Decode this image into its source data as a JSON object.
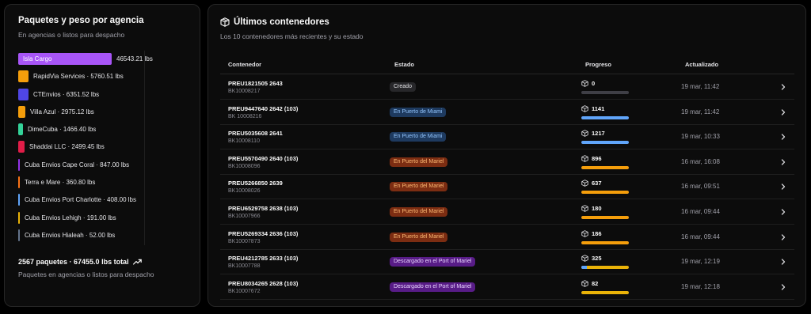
{
  "left_panel": {
    "title": "Paquetes y peso por agencia",
    "subtitle": "En agencias o listos para despacho",
    "totals": "2567 paquetes · 67455.0 lbs total",
    "totals_sub": "Paquetes en agencias o listos para despacho",
    "trend_icon": "trending-up-icon"
  },
  "chart_data": {
    "type": "bar",
    "orientation": "horizontal",
    "categories": [
      "Isla Cargo",
      "RapidVia Services",
      "CTEnvios",
      "Villa Azul",
      "DimeCuba",
      "Shaddai LLC",
      "Cuba Envios Cape Coral",
      "Terra e Mare",
      "Cuba Envios Port Charlotte",
      "Cuba Envios Lehigh",
      "Cuba Envios Hialeah"
    ],
    "values": [
      46543.21,
      5760.51,
      6351.52,
      2975.12,
      1466.4,
      2499.45,
      847.0,
      360.8,
      408.0,
      191.0,
      52.0
    ],
    "labels": [
      "46543.21 lbs",
      "RapidVia Services · 5760.51 lbs",
      "CTEnvios · 6351.52 lbs",
      "Villa Azul · 2975.12 lbs",
      "DimeCuba · 1466.40 lbs",
      "Shaddai LLC · 2499.45 lbs",
      "Cuba Envios Cape Coral · 847.00 lbs",
      "Terra e Mare · 360.80 lbs",
      "Cuba Envios Port Charlotte · 408.00 lbs",
      "Cuba Envios Lehigh · 191.00 lbs",
      "Cuba Envios Hialeah · 52.00 lbs"
    ],
    "colors": [
      "#a855f7",
      "#f59e0b",
      "#4f46e5",
      "#f59e0b",
      "#34d399",
      "#e11d48",
      "#9333ea",
      "#f97316",
      "#60a5fa",
      "#eab308",
      "#64748b"
    ],
    "inline_label_first": "Isla Cargo"
  },
  "right_panel": {
    "title": "Últimos contenedores",
    "subtitle": "Los 10 contenedores más recientes y su estado",
    "header_icon": "package-icon",
    "columns": {
      "container": "Contenedor",
      "status": "Estado",
      "progress": "Progreso",
      "updated": "Actualizado"
    }
  },
  "status_colors": {
    "created": {
      "bg": "#27272a",
      "fg": "#e4e4e7"
    },
    "miami": {
      "bg": "#1e3a5f",
      "fg": "#93c5fd"
    },
    "mariel": {
      "bg": "#7c2d12",
      "fg": "#fdba74"
    },
    "descargado": {
      "bg": "#581c87",
      "fg": "#e9d5ff"
    }
  },
  "rows": [
    {
      "id": "PREU1821505 2643",
      "bk": "BK10008217",
      "status": "Creado",
      "status_key": "created",
      "count": "0",
      "fill_pct": 0,
      "fill_color": "#3f3f46",
      "date": "19 mar, 11:42"
    },
    {
      "id": "PREU9447640 2642 (103)",
      "bk": "BK 10008216",
      "status": "En Puerto de Miami",
      "status_key": "miami",
      "count": "1141",
      "fill_pct": 100,
      "fill_color": "#60a5fa",
      "date": "19 mar, 11:42"
    },
    {
      "id": "PREU5035608 2641",
      "bk": "BK10008110",
      "status": "En Puerto de Miami",
      "status_key": "miami",
      "count": "1217",
      "fill_pct": 100,
      "fill_color": "#60a5fa",
      "date": "19 mar, 10:33"
    },
    {
      "id": "PREU5570490 2640 (103)",
      "bk": "BK10008096",
      "status": "En Puerto del Mariel",
      "status_key": "mariel",
      "count": "896",
      "fill_pct": 100,
      "fill_color": "#f59e0b",
      "date": "16 mar, 16:08"
    },
    {
      "id": "PREU5266850 2639",
      "bk": "BK10008026",
      "status": "En Puerto del Mariel",
      "status_key": "mariel",
      "count": "637",
      "fill_pct": 100,
      "fill_color": "#f59e0b",
      "date": "16 mar, 09:51"
    },
    {
      "id": "PREU6529758 2638 (103)",
      "bk": "BK10007966",
      "status": "En Puerto del Mariel",
      "status_key": "mariel",
      "count": "180",
      "fill_pct": 100,
      "fill_color": "#f59e0b",
      "date": "16 mar, 09:44"
    },
    {
      "id": "PREU5269334 2636 (103)",
      "bk": "BK10007873",
      "status": "En Puerto del Mariel",
      "status_key": "mariel",
      "count": "186",
      "fill_pct": 100,
      "fill_color": "#f59e0b",
      "date": "16 mar, 09:44"
    },
    {
      "id": "PREU4212785 2633 (103)",
      "bk": "BK10007788",
      "status": "Descargado en el Port of Mariel",
      "status_key": "descargado",
      "count": "325",
      "fill_pct": 100,
      "fill_color": "#eab308",
      "fill_prefix_pct": 12,
      "fill_prefix_color": "#60a5fa",
      "date": "19 mar, 12:19"
    },
    {
      "id": "PREU8034265 2628 (103)",
      "bk": "BK10007672",
      "status": "Descargado en el Port of Mariel",
      "status_key": "descargado",
      "count": "82",
      "fill_pct": 100,
      "fill_color": "#eab308",
      "date": "19 mar, 12:18"
    }
  ]
}
